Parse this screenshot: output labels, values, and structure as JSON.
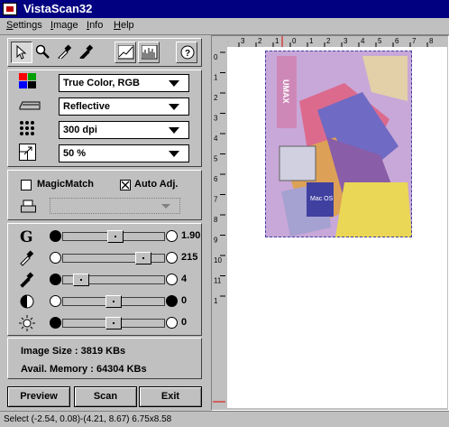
{
  "app": {
    "title": "VistaScan32"
  },
  "menu": [
    "Settings",
    "Image",
    "Info",
    "Help"
  ],
  "toolbar": {
    "tools": [
      "pointer-icon",
      "zoom-icon",
      "white-eyedropper-icon",
      "black-eyedropper-icon",
      "histogram-curve-icon",
      "histogram-bars-icon",
      "help-icon"
    ]
  },
  "settings": {
    "mode": "True Color, RGB",
    "source": "Reflective",
    "resolution": "300 dpi",
    "scale": "50 %"
  },
  "options": {
    "magic_match": {
      "label": "MagicMatch",
      "checked": false
    },
    "auto_adj": {
      "label": "Auto Adj.",
      "checked": true
    }
  },
  "adjustments": [
    {
      "name": "gamma",
      "icon": "gamma-icon",
      "value": "1.90",
      "level": 0.52
    },
    {
      "name": "highlight",
      "icon": "white-eyedropper-icon",
      "value": "215",
      "level": 0.84
    },
    {
      "name": "shadow",
      "icon": "black-eyedropper-icon",
      "value": "4",
      "level": 0.12
    },
    {
      "name": "contrast",
      "icon": "contrast-icon",
      "value": "0",
      "level": 0.5
    },
    {
      "name": "brightness",
      "icon": "brightness-icon",
      "value": "0",
      "level": 0.5
    }
  ],
  "info": {
    "image_size": "Image Size : 3819 KBs",
    "avail_memory": "Avail. Memory : 64304 KBs"
  },
  "buttons": {
    "preview": "Preview",
    "scan": "Scan",
    "exit": "Exit"
  },
  "ruler": {
    "top_labels": [
      "4",
      "3",
      "2",
      "1",
      "0",
      "1",
      "2",
      "3",
      "4",
      "5",
      "6",
      "7",
      "8"
    ],
    "left_labels": [
      "0",
      "1",
      "2",
      "3",
      "4",
      "5",
      "6",
      "7",
      "8",
      "9",
      "10",
      "11",
      "1"
    ]
  },
  "preview": {
    "box_label": "UMAX",
    "caption": "Mac OS"
  },
  "status": {
    "text": "Select (-2.54, 0.08)-(4.21, 8.67) 6.75x8.58"
  },
  "colors": {
    "title_bar": "#000080",
    "panel": "#c0c0c0",
    "selection": "#4040a0"
  }
}
